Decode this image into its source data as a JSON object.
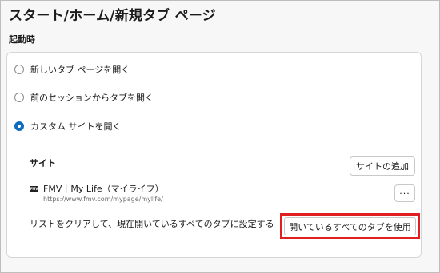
{
  "page": {
    "title": "スタート/ホーム/新規タブ ページ"
  },
  "startup": {
    "section_label": "起動時",
    "options": [
      {
        "label": "新しいタブ ページを開く",
        "selected": false
      },
      {
        "label": "前のセッションからタブを開く",
        "selected": false
      },
      {
        "label": "カスタム サイトを開く",
        "selected": true
      }
    ]
  },
  "sites": {
    "heading": "サイト",
    "add_button_label": "サイトの追加",
    "items": [
      {
        "favicon_text": "FMV",
        "name": "FMV｜My Life（マイライフ）",
        "url": "https://www.fmv.com/mypage/mylife/",
        "more_label": "···"
      }
    ],
    "clear_text": "リストをクリアして、現在開いているすべてのタブに設定する",
    "use_open_tabs_label": "開いているすべてのタブを使用"
  },
  "colors": {
    "accent": "#0f6cbd",
    "highlight": "#e02020"
  }
}
